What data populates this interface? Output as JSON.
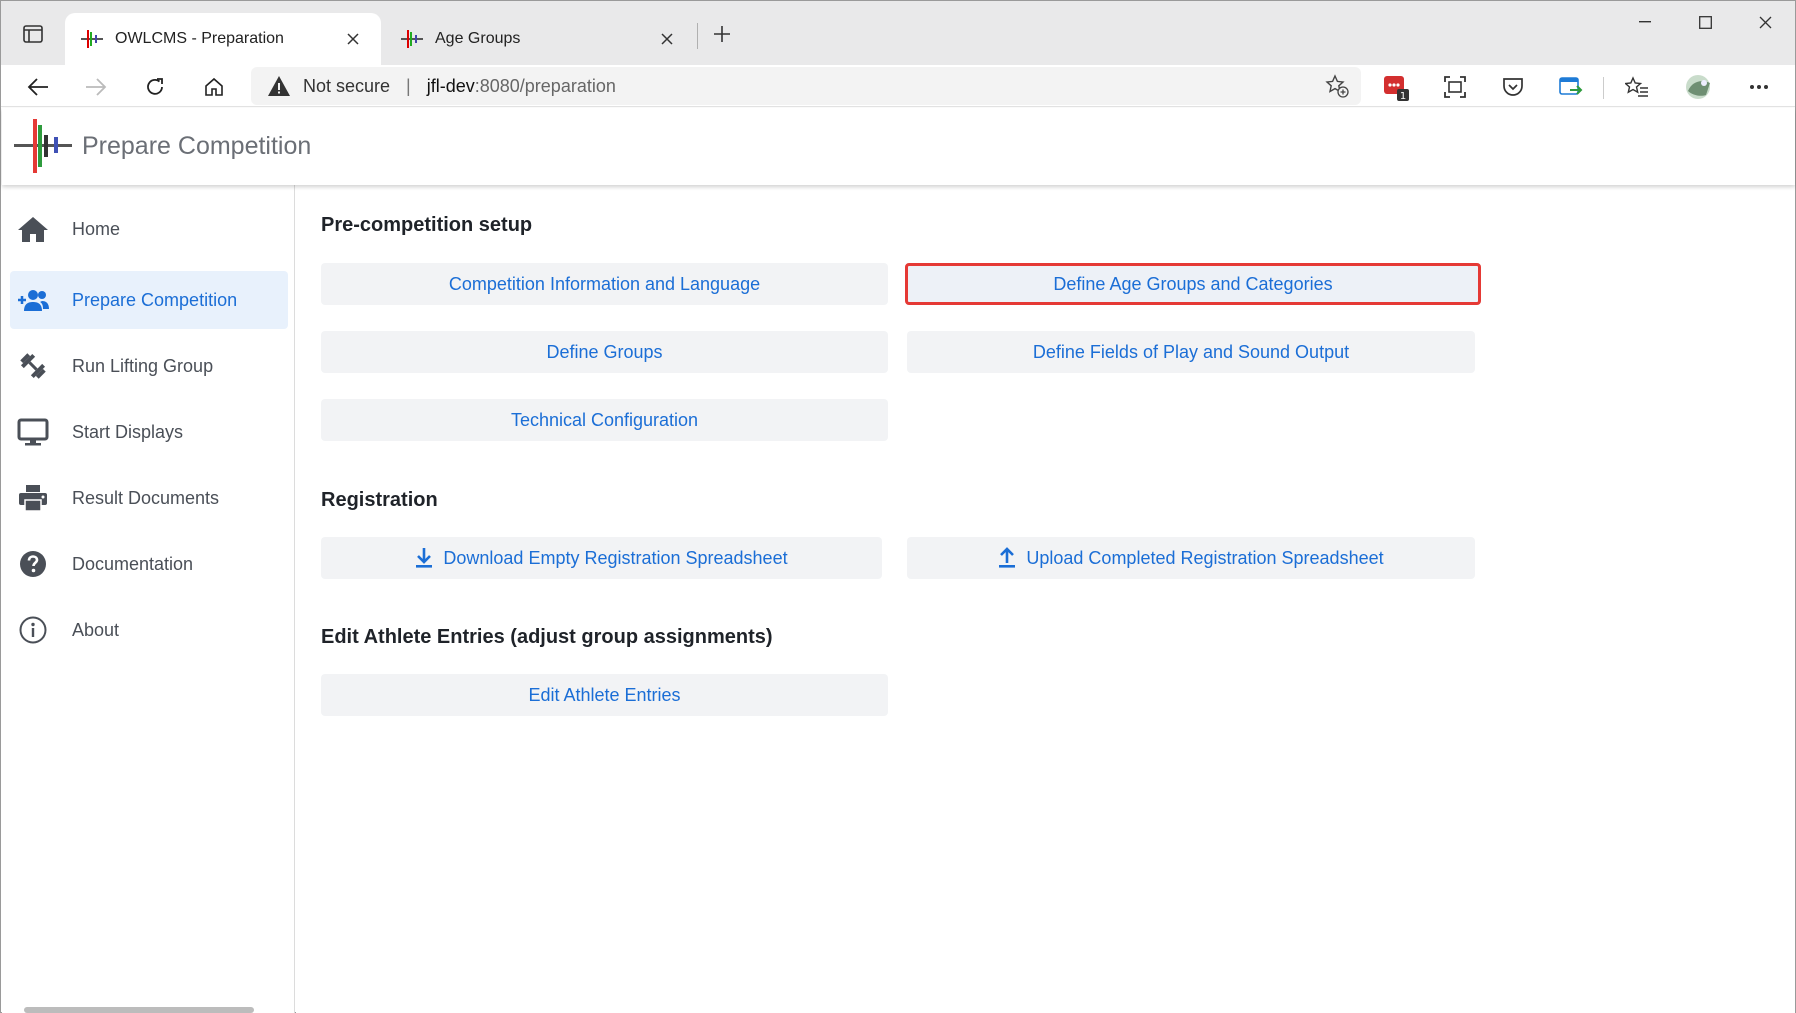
{
  "browser": {
    "tabs": [
      {
        "title": "OWLCMS - Preparation",
        "active": true
      },
      {
        "title": "Age Groups",
        "active": false
      }
    ],
    "address": {
      "security_label": "Not secure",
      "divider": "|",
      "host": "jfl-dev",
      "path": ":8080/preparation"
    },
    "extension_badge": "1"
  },
  "app": {
    "title": "Prepare Competition"
  },
  "sidebar": {
    "items": [
      {
        "label": "Home",
        "icon": "home-icon"
      },
      {
        "label": "Prepare Competition",
        "icon": "add-users-icon",
        "active": true
      },
      {
        "label": "Run Lifting Group",
        "icon": "dumbbell-icon"
      },
      {
        "label": "Start Displays",
        "icon": "monitor-icon"
      },
      {
        "label": "Result Documents",
        "icon": "printer-icon"
      },
      {
        "label": "Documentation",
        "icon": "question-icon"
      },
      {
        "label": "About",
        "icon": "info-icon"
      }
    ]
  },
  "main": {
    "sections": {
      "precompetition": {
        "title": "Pre-competition setup",
        "buttons": {
          "competition_info": "Competition Information and Language",
          "age_groups": "Define Age Groups and Categories",
          "groups": "Define Groups",
          "fields_of_play": "Define Fields of Play and Sound Output",
          "technical": "Technical Configuration"
        }
      },
      "registration": {
        "title": "Registration",
        "buttons": {
          "download": "Download Empty Registration Spreadsheet",
          "upload": "Upload Completed Registration Spreadsheet"
        }
      },
      "athletes": {
        "title": "Edit Athlete Entries (adjust group assignments)",
        "buttons": {
          "edit": "Edit Athlete Entries"
        }
      }
    }
  },
  "colors": {
    "accent": "#1b6ed6",
    "highlight_outline": "#e53935",
    "active_nav_bg": "#e8f1fc",
    "button_bg": "#f2f3f5"
  }
}
